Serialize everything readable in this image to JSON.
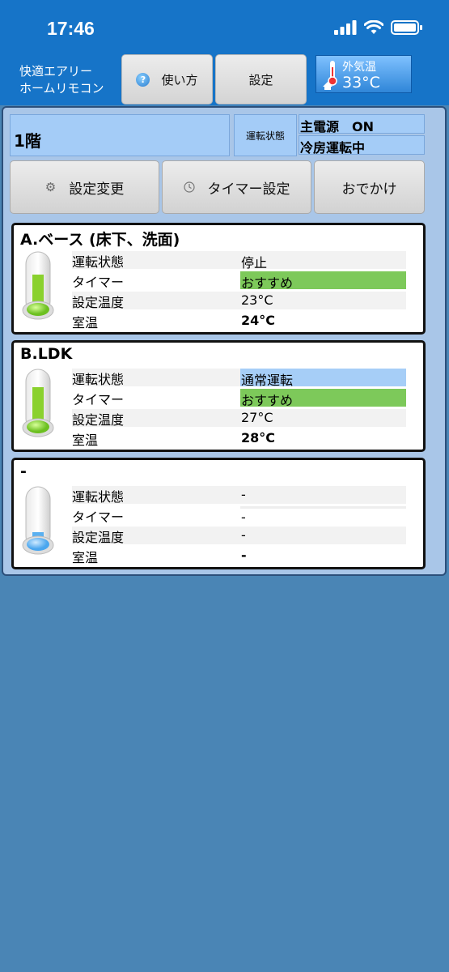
{
  "status_bar": {
    "time": "17:46"
  },
  "header": {
    "app_title_line1": "快適エアリー",
    "app_title_line2": "ホームリモコン",
    "help_label": "使い方",
    "settings_label": "設定",
    "outdoor_label": "外気温",
    "outdoor_temp": "33°C"
  },
  "panel": {
    "floor": "1階",
    "run_state_label": "運転状態",
    "main_power": "主電源　ON",
    "mode": "冷房運転中"
  },
  "actions": {
    "settings_change": "設定変更",
    "timer_settings": "タイマー設定",
    "outing": "おでかけ"
  },
  "labels": {
    "run_state": "運転状態",
    "timer": "タイマー",
    "set_temp": "設定温度",
    "room_temp": "室温"
  },
  "zones": [
    {
      "name": "A.ベース (床下、洗面)",
      "run_state": "停止",
      "timer": "おすすめ",
      "set_temp": "23°C",
      "room_temp": "24°C",
      "thermo_color": "green"
    },
    {
      "name": "B.LDK",
      "run_state": "通常運転",
      "timer": "おすすめ",
      "set_temp": "27°C",
      "room_temp": "28°C",
      "thermo_color": "green"
    },
    {
      "name": "-",
      "run_state": "-",
      "timer": "-",
      "set_temp": "-",
      "room_temp": "-",
      "thermo_color": "blue"
    }
  ],
  "colors": {
    "header_blue": "#1674c8",
    "background": "#4a85b5",
    "recommended_green": "#7dc95a",
    "normal_run_blue": "#a6cef7"
  }
}
